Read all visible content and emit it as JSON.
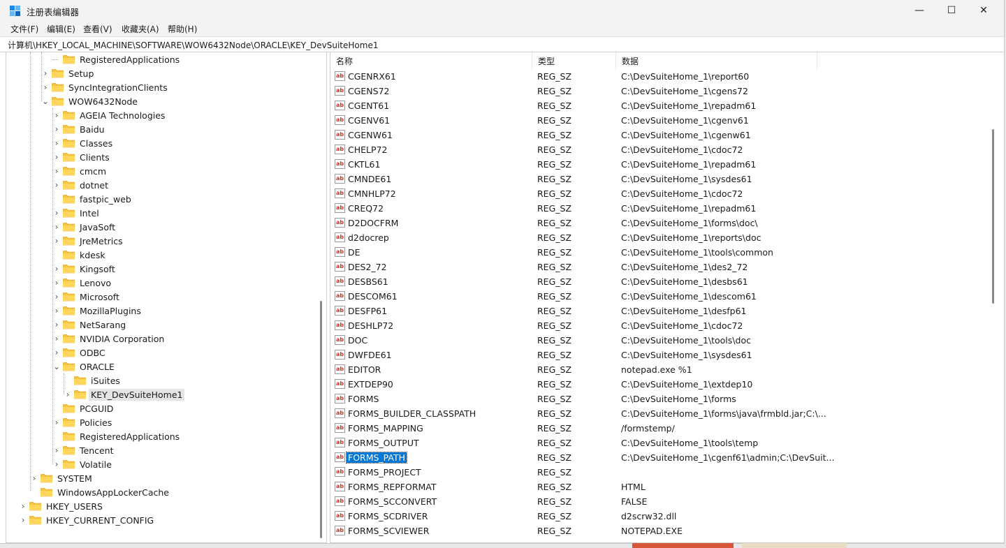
{
  "window": {
    "title": "注册表编辑器",
    "buttons": {
      "minimize": "—",
      "maximize": "☐",
      "close": "✕"
    }
  },
  "menu": [
    "文件(F)",
    "编辑(E)",
    "查看(V)",
    "收藏夹(A)",
    "帮助(H)"
  ],
  "address": "计算机\\HKEY_LOCAL_MACHINE\\SOFTWARE\\WOW6432Node\\ORACLE\\KEY_DevSuiteHome1",
  "tree": [
    {
      "label": "RegisteredApplications"
    },
    {
      "label": "Setup"
    },
    {
      "label": "SyncIntegrationClients"
    },
    {
      "label": "WOW6432Node"
    },
    {
      "label": "AGEIA Technologies"
    },
    {
      "label": "Baidu"
    },
    {
      "label": "Classes"
    },
    {
      "label": "Clients"
    },
    {
      "label": "cmcm"
    },
    {
      "label": "dotnet"
    },
    {
      "label": "fastpic_web"
    },
    {
      "label": "Intel"
    },
    {
      "label": "JavaSoft"
    },
    {
      "label": "JreMetrics"
    },
    {
      "label": "kdesk"
    },
    {
      "label": "Kingsoft"
    },
    {
      "label": "Lenovo"
    },
    {
      "label": "Microsoft"
    },
    {
      "label": "MozillaPlugins"
    },
    {
      "label": "NetSarang"
    },
    {
      "label": "NVIDIA Corporation"
    },
    {
      "label": "ODBC"
    },
    {
      "label": "ORACLE"
    },
    {
      "label": "iSuites"
    },
    {
      "label": "KEY_DevSuiteHome1"
    },
    {
      "label": "PCGUID"
    },
    {
      "label": "Policies"
    },
    {
      "label": "RegisteredApplications"
    },
    {
      "label": "Tencent"
    },
    {
      "label": "Volatile"
    },
    {
      "label": "SYSTEM"
    },
    {
      "label": "WindowsAppLockerCache"
    },
    {
      "label": "HKEY_USERS"
    },
    {
      "label": "HKEY_CURRENT_CONFIG"
    }
  ],
  "columns": {
    "name": "名称",
    "type": "类型",
    "data": "数据"
  },
  "values": [
    {
      "name": "CGENRX61",
      "type": "REG_SZ",
      "data": "C:\\DevSuiteHome_1\\report60"
    },
    {
      "name": "CGENS72",
      "type": "REG_SZ",
      "data": "C:\\DevSuiteHome_1\\cgens72"
    },
    {
      "name": "CGENT61",
      "type": "REG_SZ",
      "data": "C:\\DevSuiteHome_1\\repadm61"
    },
    {
      "name": "CGENV61",
      "type": "REG_SZ",
      "data": "C:\\DevSuiteHome_1\\cgenv61"
    },
    {
      "name": "CGENW61",
      "type": "REG_SZ",
      "data": "C:\\DevSuiteHome_1\\cgenw61"
    },
    {
      "name": "CHELP72",
      "type": "REG_SZ",
      "data": "C:\\DevSuiteHome_1\\cdoc72"
    },
    {
      "name": "CKTL61",
      "type": "REG_SZ",
      "data": "C:\\DevSuiteHome_1\\repadm61"
    },
    {
      "name": "CMNDE61",
      "type": "REG_SZ",
      "data": "C:\\DevSuiteHome_1\\sysdes61"
    },
    {
      "name": "CMNHLP72",
      "type": "REG_SZ",
      "data": "C:\\DevSuiteHome_1\\cdoc72"
    },
    {
      "name": "CREQ72",
      "type": "REG_SZ",
      "data": "C:\\DevSuiteHome_1\\repadm61"
    },
    {
      "name": "D2DOCFRM",
      "type": "REG_SZ",
      "data": "C:\\DevSuiteHome_1\\forms\\doc\\"
    },
    {
      "name": "d2docrep",
      "type": "REG_SZ",
      "data": "C:\\DevSuiteHome_1\\reports\\doc"
    },
    {
      "name": "DE",
      "type": "REG_SZ",
      "data": "C:\\DevSuiteHome_1\\tools\\common"
    },
    {
      "name": "DES2_72",
      "type": "REG_SZ",
      "data": "C:\\DevSuiteHome_1\\des2_72"
    },
    {
      "name": "DESBS61",
      "type": "REG_SZ",
      "data": "C:\\DevSuiteHome_1\\desbs61"
    },
    {
      "name": "DESCOM61",
      "type": "REG_SZ",
      "data": "C:\\DevSuiteHome_1\\descom61"
    },
    {
      "name": "DESFP61",
      "type": "REG_SZ",
      "data": "C:\\DevSuiteHome_1\\desfp61"
    },
    {
      "name": "DESHLP72",
      "type": "REG_SZ",
      "data": "C:\\DevSuiteHome_1\\cdoc72"
    },
    {
      "name": "DOC",
      "type": "REG_SZ",
      "data": "C:\\DevSuiteHome_1\\tools\\doc"
    },
    {
      "name": "DWFDE61",
      "type": "REG_SZ",
      "data": "C:\\DevSuiteHome_1\\sysdes61"
    },
    {
      "name": "EDITOR",
      "type": "REG_SZ",
      "data": "notepad.exe %1"
    },
    {
      "name": "EXTDEP90",
      "type": "REG_SZ",
      "data": "C:\\DevSuiteHome_1\\extdep10"
    },
    {
      "name": "FORMS",
      "type": "REG_SZ",
      "data": "C:\\DevSuiteHome_1\\forms"
    },
    {
      "name": "FORMS_BUILDER_CLASSPATH",
      "type": "REG_SZ",
      "data": "C:\\DevSuiteHome_1\\forms\\java\\frmbld.jar;C:\\..."
    },
    {
      "name": "FORMS_MAPPING",
      "type": "REG_SZ",
      "data": "/formstemp/"
    },
    {
      "name": "FORMS_OUTPUT",
      "type": "REG_SZ",
      "data": "C:\\DevSuiteHome_1\\tools\\temp"
    },
    {
      "name": "FORMS_PATH",
      "type": "REG_SZ",
      "data": "C:\\DevSuiteHome_1\\cgenf61\\admin;C:\\DevSuit..."
    },
    {
      "name": "FORMS_PROJECT",
      "type": "REG_SZ",
      "data": ""
    },
    {
      "name": "FORMS_REPFORMAT",
      "type": "REG_SZ",
      "data": "HTML"
    },
    {
      "name": "FORMS_SCCONVERT",
      "type": "REG_SZ",
      "data": "FALSE"
    },
    {
      "name": "FORMS_SCDRIVER",
      "type": "REG_SZ",
      "data": "d2scrw32.dll"
    },
    {
      "name": "FORMS_SCVIEWER",
      "type": "REG_SZ",
      "data": "NOTEPAD.EXE"
    }
  ],
  "colors": {
    "selection": "#0078d7",
    "tree_selection": "#e5e5e5",
    "folder": "#f5c542",
    "chrome": "#f3f3f3"
  }
}
